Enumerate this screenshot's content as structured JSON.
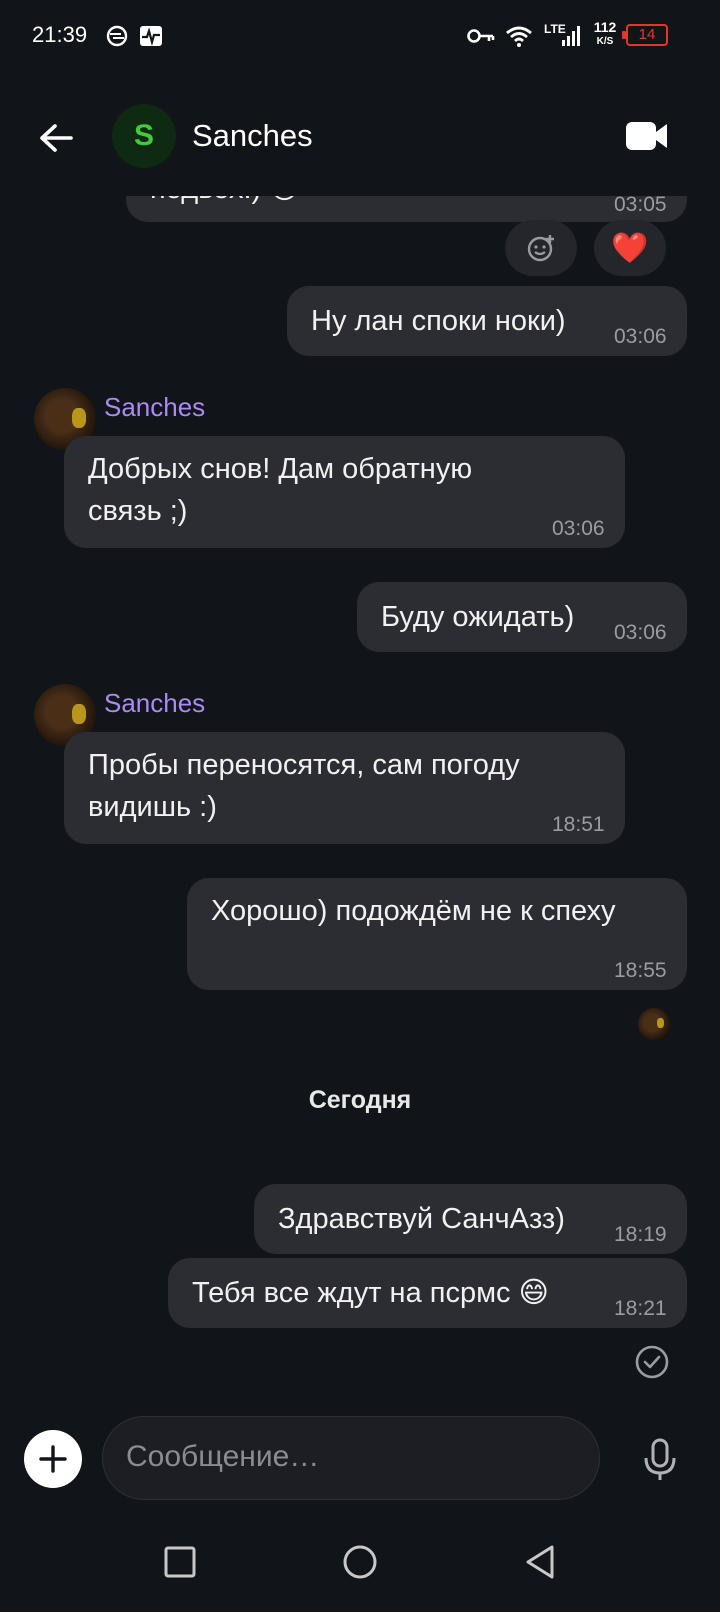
{
  "status_bar": {
    "time": "21:39",
    "network": "LTE",
    "speed_value": "112",
    "speed_unit": "K/S",
    "battery": "14",
    "icons": [
      "sync-icon",
      "activity-icon",
      "vpn-key-icon",
      "wifi-icon",
      "signal-icon",
      "battery-icon"
    ]
  },
  "header": {
    "avatar_letter": "S",
    "title": "Sanches",
    "icons": [
      "back-arrow-icon",
      "video-call-icon"
    ]
  },
  "messages": [
    {
      "id": "m0",
      "direction": "in",
      "text": "подвох!) 😉",
      "time": "03:05",
      "partial": true
    },
    {
      "id": "m1",
      "direction": "out",
      "text": "Ну лан споки ноки)",
      "time": "03:06"
    },
    {
      "id": "m2",
      "direction": "in",
      "sender": "Sanches",
      "lines": [
        "Добрых снов! Дам обратную",
        "связь ;)"
      ],
      "time": "03:06"
    },
    {
      "id": "m3",
      "direction": "out",
      "text": "Буду ожидать)",
      "time": "03:06"
    },
    {
      "id": "m4",
      "direction": "in",
      "sender": "Sanches",
      "lines": [
        "Пробы переносятся, сам погоду",
        "видишь :)"
      ],
      "time": "18:51"
    },
    {
      "id": "m5",
      "direction": "out",
      "text": "Хорошо) подождём не к спеху",
      "time": "18:55"
    },
    {
      "id": "m6",
      "direction": "out",
      "text": "Здравствуй СанчАзз)",
      "time": "18:19"
    },
    {
      "id": "m7",
      "direction": "out",
      "text": "Тебя все ждут на псрмс 😄",
      "time": "18:21"
    }
  ],
  "reactions": {
    "add_icon": "add-reaction-icon",
    "emoji": "❤️"
  },
  "date_separator": "Сегодня",
  "composer": {
    "placeholder": "Сообщение…",
    "icons": [
      "add-icon",
      "microphone-icon"
    ]
  },
  "delivery_status_icon": "check-circle-icon",
  "nav": {
    "icons": [
      "recents-square-icon",
      "home-circle-icon",
      "back-triangle-icon"
    ]
  },
  "colors": {
    "background": "#111418",
    "bubble": "#2b2d33",
    "sender_name": "#a98bf2",
    "avatar_letter": "#3fcb3a",
    "battery_low": "#e0392b"
  }
}
